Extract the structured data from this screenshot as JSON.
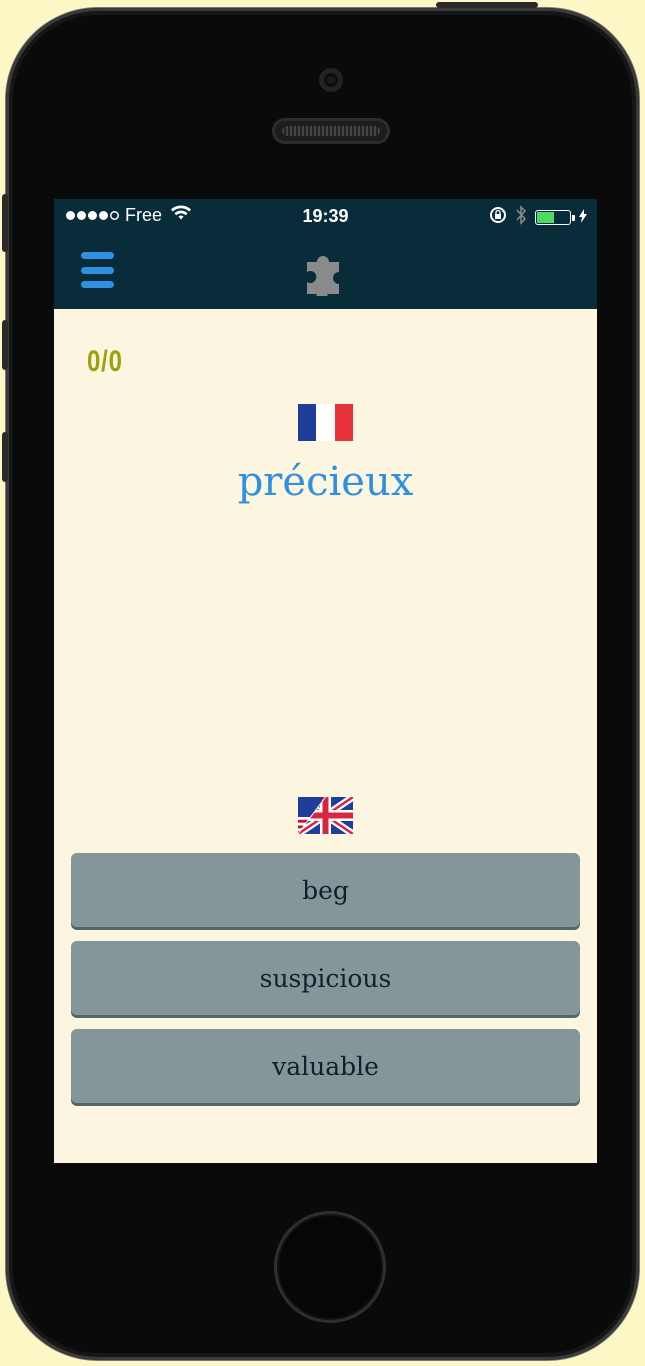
{
  "status_bar": {
    "carrier": "Free",
    "time": "19:39",
    "signal_icon": "signal-dots-icon",
    "wifi_icon": "wifi-icon",
    "lock_rotation_icon": "rotation-lock-icon",
    "bluetooth_icon": "bluetooth-icon",
    "battery_icon": "battery-icon",
    "charging_icon": "charging-bolt-icon",
    "battery_level": 0.5
  },
  "nav": {
    "menu_icon": "hamburger-menu-icon",
    "logo_icon": "puzzle-piece-icon"
  },
  "quiz": {
    "score": "0/0",
    "source_flag": "france-flag-icon",
    "word": "précieux",
    "target_flag": "us-uk-flag-icon",
    "answers": [
      "beg",
      "suspicious",
      "valuable"
    ]
  },
  "colors": {
    "background": "#fdf7c6",
    "screen_bg": "#fcf5df",
    "bar_bg": "#082c39",
    "accent_blue": "#2f8fe0",
    "score_color": "#9aa30c",
    "answer_bg": "#85969a",
    "answer_text": "#10212a",
    "puzzle_gray": "#8a8a8a"
  }
}
